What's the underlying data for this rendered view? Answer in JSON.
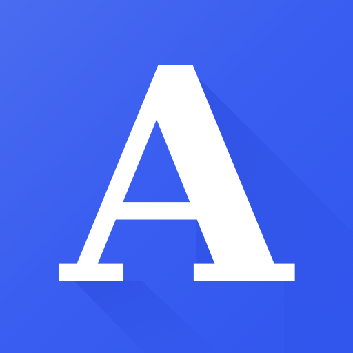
{
  "icon": {
    "letter": "A",
    "background_color": "#3a5ef0",
    "letter_color": "#ffffff",
    "shadow_color": "#1e3fcf"
  }
}
